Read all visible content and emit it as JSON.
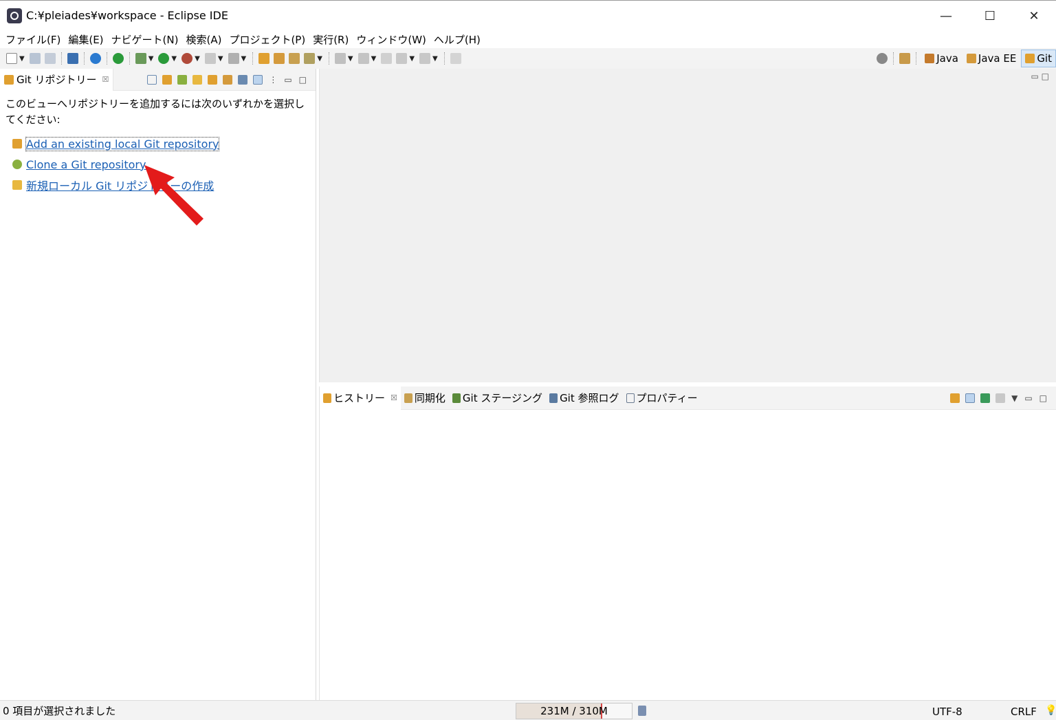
{
  "window": {
    "title": "C:¥pleiades¥workspace - Eclipse IDE",
    "controls": {
      "minimize": "—",
      "maximize": "☐",
      "close": "✕"
    }
  },
  "menubar": {
    "items": [
      "ファイル(F)",
      "編集(E)",
      "ナビゲート(N)",
      "検索(A)",
      "プロジェクト(P)",
      "実行(R)",
      "ウィンドウ(W)",
      "ヘルプ(H)"
    ]
  },
  "perspectives": {
    "items": [
      {
        "label": "Java",
        "icon": "java-perspective-icon",
        "color": "#c47a2c"
      },
      {
        "label": "Java EE",
        "icon": "javaee-perspective-icon",
        "color": "#d49a3c"
      },
      {
        "label": "Git",
        "icon": "git-perspective-icon",
        "color": "#e0a030",
        "active": true
      }
    ]
  },
  "git_view": {
    "tab_label": "Git リポジトリー",
    "tab_close": "☒",
    "intro": "このビューへリポジトリーを追加するには次のいずれかを選択してください:",
    "links": [
      {
        "label": "Add an existing local Git repository",
        "icon": "add-repo-icon"
      },
      {
        "label": "Clone a Git repository",
        "icon": "clone-repo-icon"
      },
      {
        "label": "新規ローカル Git リポジトリーの作成",
        "icon": "new-repo-icon"
      }
    ]
  },
  "bottom_tabs": {
    "items": [
      {
        "label": "ヒストリー",
        "icon": "history-icon",
        "active": true,
        "close": "☒"
      },
      {
        "label": "同期化",
        "icon": "synchronize-icon"
      },
      {
        "label": "Git ステージング",
        "icon": "git-staging-icon"
      },
      {
        "label": "Git 参照ログ",
        "icon": "reflog-icon"
      },
      {
        "label": "プロパティー",
        "icon": "properties-icon"
      }
    ]
  },
  "statusbar": {
    "selection": "0 項目が選択されました",
    "heap": "231M / 310M",
    "heap_used_fraction": 0.745,
    "encoding": "UTF-8",
    "line_ending": "CRLF"
  },
  "colors": {
    "link": "#1a5fb4",
    "arrow": "#e31b1b",
    "active_perspective": "#d9e8f7"
  }
}
